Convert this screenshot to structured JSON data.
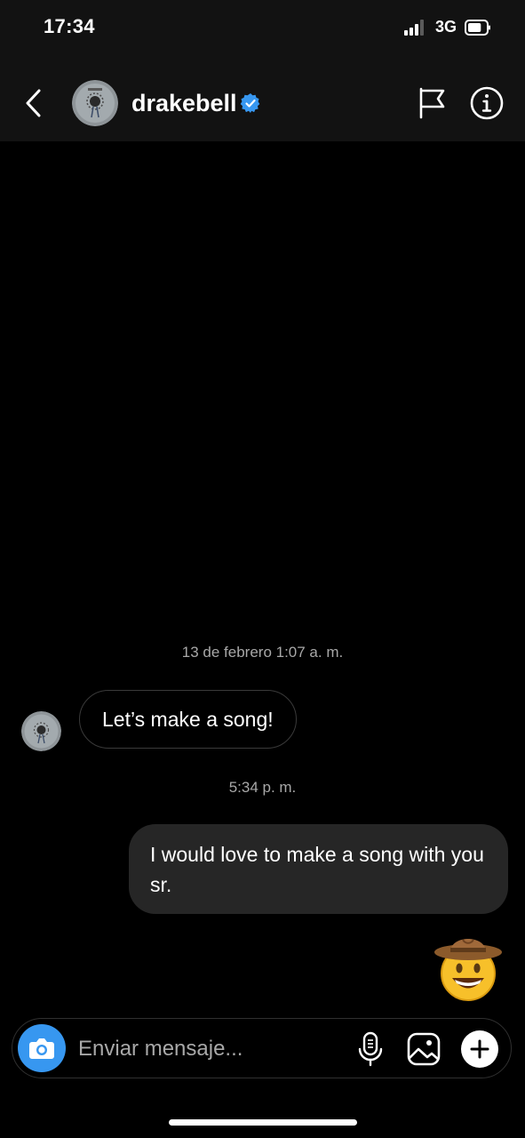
{
  "status_bar": {
    "time": "17:34",
    "network": "3G",
    "signal_bars": 3,
    "battery_level": 0.75
  },
  "header": {
    "username": "drakebell",
    "verified": true,
    "icons": {
      "back": "chevron-left-icon",
      "report": "flag-icon",
      "info": "info-icon"
    }
  },
  "conversation": {
    "timestamp_1": "13 de febrero 1:07 a. m.",
    "incoming_message": "Let’s make a song!",
    "timestamp_2": "5:34 p. m.",
    "outgoing_message": "I would love to make a song with you sr.",
    "emoji_message": "cowboy-hat-face-emoji"
  },
  "composer": {
    "placeholder": "Enviar mensaje...",
    "value": "",
    "icons": {
      "camera": "camera-icon",
      "mic": "microphone-icon",
      "gallery": "image-icon",
      "plus": "plus-icon"
    }
  },
  "colors": {
    "background": "#000000",
    "header_background": "#121212",
    "outgoing_bubble": "#262626",
    "incoming_bubble_border": "#3a3a3a",
    "timestamp_text": "#a8a8a8",
    "verified_badge": "#3797f0",
    "camera_button": "#3797f0"
  }
}
